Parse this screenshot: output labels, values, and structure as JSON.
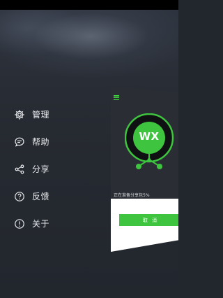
{
  "menu": {
    "items": [
      {
        "label": "管理",
        "icon": "gear-icon"
      },
      {
        "label": "帮助",
        "icon": "chat-bubble-icon"
      },
      {
        "label": "分享",
        "icon": "share-icon"
      },
      {
        "label": "反馈",
        "icon": "question-icon"
      },
      {
        "label": "关于",
        "icon": "info-icon"
      }
    ]
  },
  "preview": {
    "logo_text": "WX",
    "progress_text": "正在准备分享包5%",
    "progress_percent": 5,
    "cancel_label": "取 消"
  },
  "colors": {
    "accent": "#3ec43e",
    "background": "#22262d",
    "text": "#e8eaed"
  }
}
